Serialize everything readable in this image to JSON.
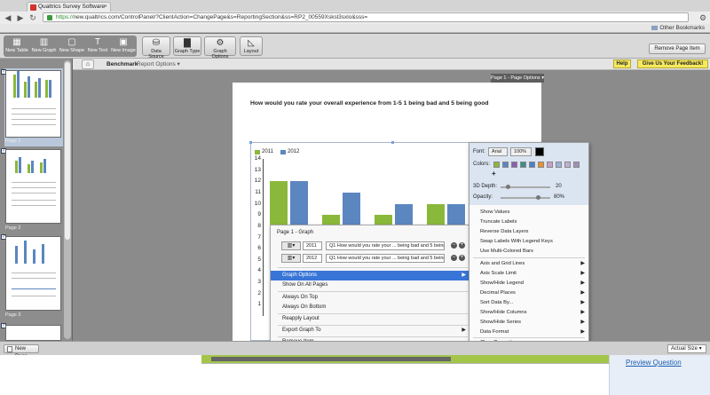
{
  "browser": {
    "tab_title": "Qualtrics Survey Software",
    "url_scheme": "https://",
    "url_rest": "new.qualtrics.com/ControlPanel/?ClientAction=ChangePage&s=ReportingSection&ss=RP2_00559Xsksl3sxlo&sss=",
    "other_bookmarks": "Other Bookmarks"
  },
  "toolbar": {
    "new_table": "New Table",
    "new_graph": "New Graph",
    "new_shape": "New Shape",
    "new_text": "New Text",
    "new_image": "New Image",
    "data_source": "Data Source",
    "graph_type": "Graph Type",
    "graph_options": "Graph Options",
    "layout": "Layout",
    "remove_page_item": "Remove Page Item"
  },
  "breadcrumb": {
    "benchmark": "Benchmark",
    "report_options": "Report Options ▾"
  },
  "help": "Help",
  "feedback": "Give Us Your Feedback!",
  "sidebar": {
    "pages": [
      "Page 1",
      "Page 2",
      "Page 3"
    ]
  },
  "page_options": "Page 1 - Page Options ▾",
  "question_title": "How would you rate your overall experience from 1-5 1 being bad and 5 being good",
  "chart_data": {
    "type": "bar",
    "series": [
      {
        "name": "2011",
        "values": [
          12,
          9,
          9,
          10
        ],
        "color": "#8ab83a"
      },
      {
        "name": "2012",
        "values": [
          12,
          11,
          10,
          10
        ],
        "color": "#5b86c0"
      }
    ],
    "yticks": [
      "14",
      "13",
      "12",
      "11",
      "10",
      "9",
      "8",
      "7",
      "6",
      "5",
      "4",
      "3",
      "2",
      "1"
    ],
    "ylim": [
      0,
      14
    ]
  },
  "context_menu": {
    "header": "Page 1 - Graph",
    "rows": [
      {
        "year": "2011",
        "question": "Q1 How would you rate your ... being bad and 5 being good"
      },
      {
        "year": "2012",
        "question": "Q1 How would you rate your ... being bad and 5 being good"
      }
    ],
    "items": [
      "Graph Options",
      "Show On All Pages",
      "Always On Top",
      "Always On Bottom",
      "Reapply Layout",
      "Export Graph To",
      "Remove Item"
    ]
  },
  "graph_options": {
    "font_label": "Font:",
    "font_value": "Arial",
    "font_size": "100%",
    "colors_label": "Colors:",
    "swatches": [
      "#8ab83a",
      "#5b86c0",
      "#8b5fb0",
      "#3a8f8a",
      "#4c7fc2",
      "#e8912d",
      "#c8a0c8",
      "#9bb2d8",
      "#c0b0d0",
      "#a090b8"
    ],
    "depth_label": "3D Depth:",
    "depth_value": "20",
    "opacity_label": "Opacity:",
    "opacity_value": "80%",
    "items_a": [
      "Show Values",
      "Truncate Labels",
      "Reverse Data Layers",
      "Swap Labels With Legend Keys",
      "Use Multi-Colored Bars"
    ],
    "items_b": [
      "Axis and Grid Lines",
      "Axis Scale Limit",
      "Show/Hide Legend",
      "Decimal Places",
      "Sort Data By...",
      "Show/Hide Columns",
      "Show/Hide Series",
      "Data Format"
    ],
    "clear": "Clear Properties"
  },
  "bottom": {
    "new_page": "New Page",
    "actual_size": "Actual Size ▾",
    "preview_question": "Preview Question"
  }
}
